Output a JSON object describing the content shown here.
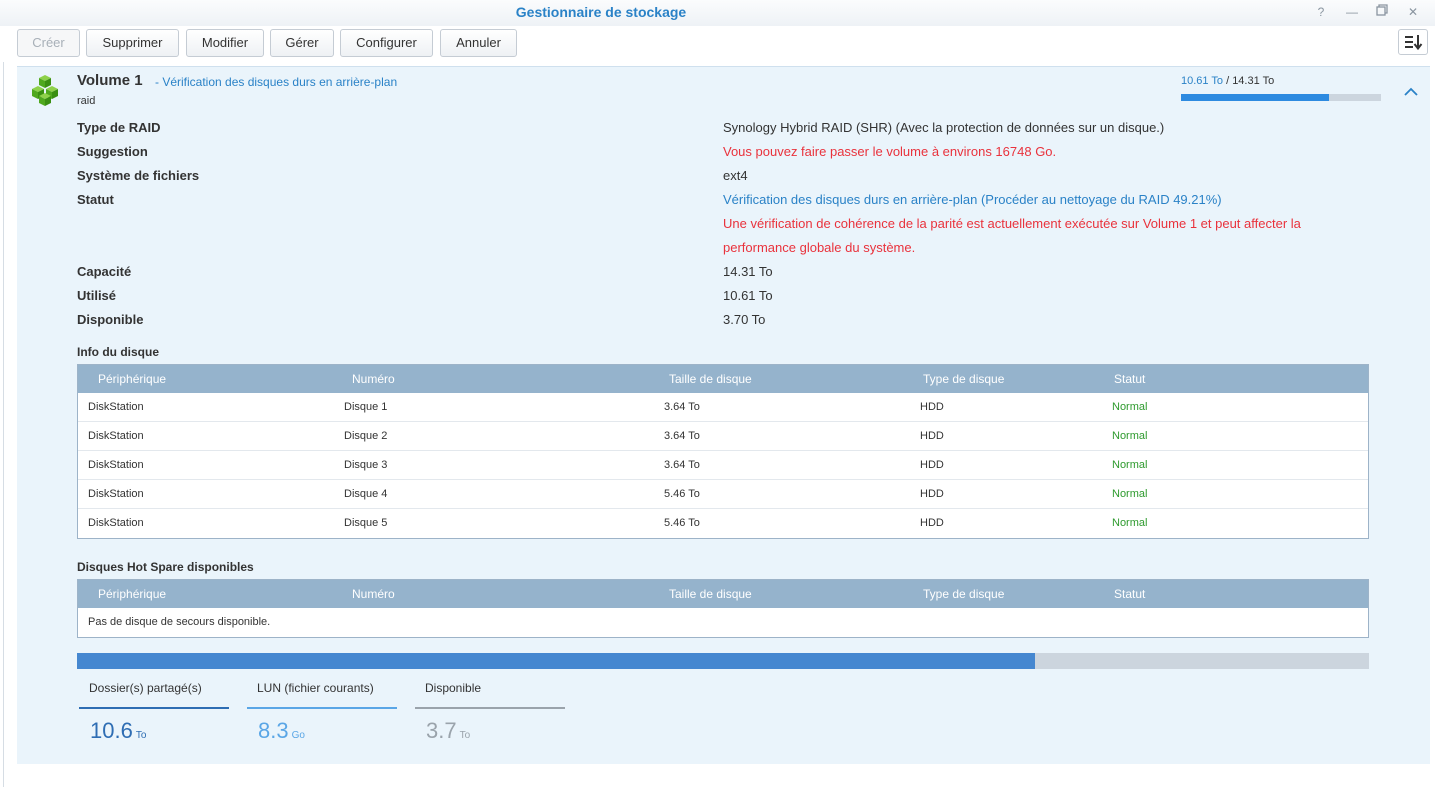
{
  "window": {
    "title": "Gestionnaire de stockage",
    "help_glyph": "?",
    "minimize_glyph": "—",
    "maximize_glyph": "❐",
    "close_glyph": "✕"
  },
  "toolbar": {
    "create": "Créer",
    "delete": "Supprimer",
    "edit": "Modifier",
    "manage": "Gérer",
    "configure": "Configurer",
    "cancel": "Annuler"
  },
  "volume": {
    "name": "Volume 1",
    "status_subtitle": "- Vérification des disques durs en arrière-plan",
    "description": "raid",
    "used_display": "10.61 To",
    "separator": " / ",
    "total_display": "14.31 To",
    "usage_fraction": 0.7414,
    "icon": "volume-cubes-icon",
    "color_accent": "#2a82c7"
  },
  "details": {
    "raid_type_label": "Type de RAID",
    "raid_type_value": "Synology Hybrid RAID (SHR) (Avec la protection de données sur un disque.)",
    "suggestion_label": "Suggestion",
    "suggestion_value": "Vous pouvez faire passer le volume à environs 16748 Go.",
    "filesystem_label": "Système de fichiers",
    "filesystem_value": "ext4",
    "status_label": "Statut",
    "status_value": "Vérification des disques durs en arrière-plan (Procéder au nettoyage du RAID 49.21%)",
    "status_warning_line1": "Une vérification de cohérence de la parité est actuellement exécutée sur Volume 1 et peut affecter la",
    "status_warning_line2": "performance globale du système.",
    "capacity_label": "Capacité",
    "capacity_value": "14.31 To",
    "used_label": "Utilisé",
    "used_value": "10.61 To",
    "available_label": "Disponible",
    "available_value": "3.70 To"
  },
  "disk_info": {
    "title": "Info du disque",
    "columns": [
      "Périphérique",
      "Numéro",
      "Taille de disque",
      "Type de disque",
      "Statut"
    ],
    "rows": [
      [
        "DiskStation",
        "Disque 1",
        "3.64 To",
        "HDD",
        "Normal"
      ],
      [
        "DiskStation",
        "Disque 2",
        "3.64 To",
        "HDD",
        "Normal"
      ],
      [
        "DiskStation",
        "Disque 3",
        "3.64 To",
        "HDD",
        "Normal"
      ],
      [
        "DiskStation",
        "Disque 4",
        "5.46 To",
        "HDD",
        "Normal"
      ],
      [
        "DiskStation",
        "Disque 5",
        "5.46 To",
        "HDD",
        "Normal"
      ]
    ]
  },
  "hot_spare": {
    "title": "Disques Hot Spare disponibles",
    "columns": [
      "Périphérique",
      "Numéro",
      "Taille de disque",
      "Type de disque",
      "Statut"
    ],
    "empty_message": "Pas de disque de secours disponible."
  },
  "usage": {
    "bar_fraction": 0.7414,
    "items": [
      {
        "label": "Dossier(s) partagé(s)",
        "value": "10.6",
        "unit": "To",
        "color": "#2e6db3"
      },
      {
        "label": "LUN (fichier courants)",
        "value": "8.3",
        "unit": "Go",
        "color": "#5aa6e6"
      },
      {
        "label": "Disponible",
        "value": "3.7",
        "unit": "To",
        "color": "#9aa3ab"
      }
    ]
  }
}
